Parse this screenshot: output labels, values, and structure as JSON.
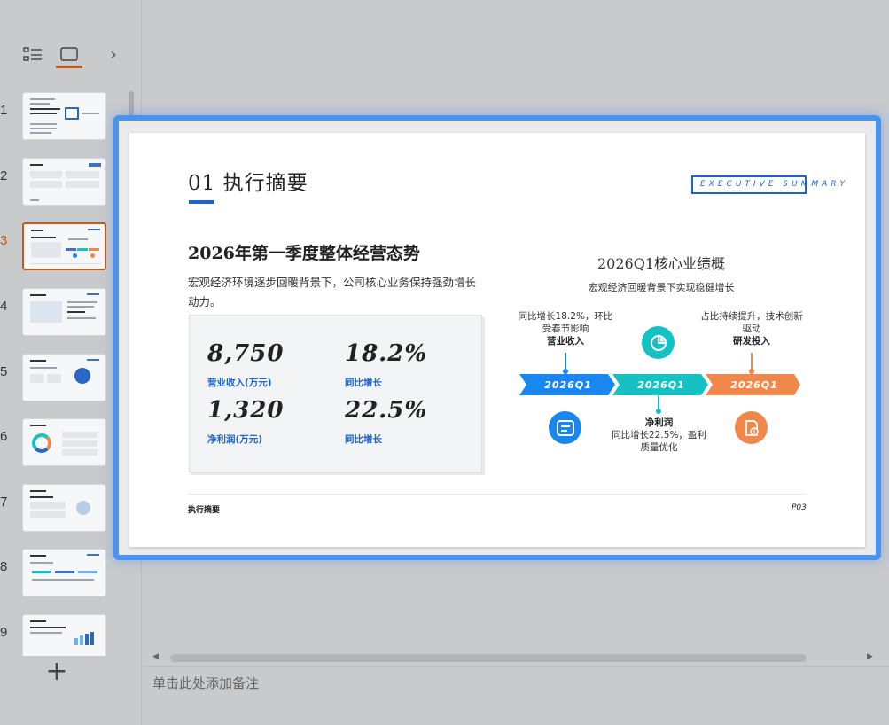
{
  "panel": {
    "chevron": "›",
    "add_label": "+"
  },
  "thumbnails": [
    {
      "num": "1",
      "active": false
    },
    {
      "num": "2",
      "active": false
    },
    {
      "num": "3",
      "active": true
    },
    {
      "num": "4",
      "active": false
    },
    {
      "num": "5",
      "active": false
    },
    {
      "num": "6",
      "active": false
    },
    {
      "num": "7",
      "active": false
    },
    {
      "num": "8",
      "active": false
    },
    {
      "num": "9",
      "active": false
    }
  ],
  "slide": {
    "title": "01 执行摘要",
    "tag": "EXECUTIVE SUMMARY",
    "subtitle": "2026年第一季度整体经营态势",
    "intro": "宏观经济环境逐步回暖背景下，公司核心业务保持强劲增长动力。",
    "stats": [
      {
        "value": "8,750",
        "label": "营业收入(万元)"
      },
      {
        "value": "18.2%",
        "label": "同比增长"
      },
      {
        "value": "1,320",
        "label": "净利润(万元)"
      },
      {
        "value": "22.5%",
        "label": "同比增长"
      }
    ],
    "perf_title": "2026Q1核心业绩概",
    "perf_sub": "宏观经济回暖背景下实现稳健增长",
    "timeline": [
      {
        "label": "2026Q1",
        "note_title": "营业收入",
        "note_text": "同比增长18.2%，环比受春节影响",
        "color": "#1a86f0",
        "icon": "list-icon"
      },
      {
        "label": "2026Q1",
        "note_title": "净利润",
        "note_text": "同比增长22.5%，盈利质量优化",
        "color": "#16c1c4",
        "icon": "pie-chart-icon"
      },
      {
        "label": "2026Q1",
        "note_title": "研发投入",
        "note_text": "占比持续提升，技术创新驱动",
        "color": "#f0874b",
        "icon": "document-dollar-icon"
      }
    ],
    "footer_left": "执行摘要",
    "footer_right": "P03"
  },
  "notes_placeholder": "单击此处添加备注"
}
